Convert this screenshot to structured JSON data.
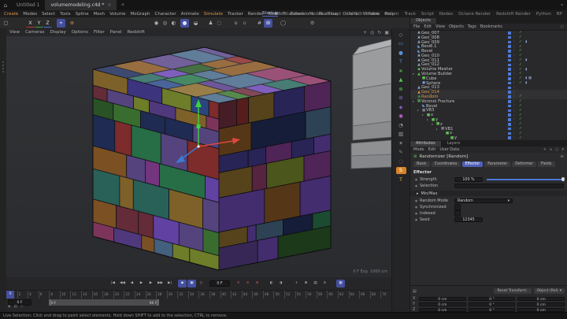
{
  "window": {
    "title_icon": "⌂",
    "tabs": [
      {
        "label": "Untitled 1",
        "active": false
      },
      {
        "label": "volumemodeling.c4d *",
        "active": true
      }
    ],
    "close_glyph": "×",
    "new_tab_glyph": "+",
    "corner_glyph": "▾"
  },
  "menubar": {
    "items": [
      {
        "label": "Create",
        "accent": true
      },
      {
        "label": "Modes"
      },
      {
        "label": "Select"
      },
      {
        "label": "Tools"
      },
      {
        "label": "Spline"
      },
      {
        "label": "Mesh"
      },
      {
        "label": "Volume"
      },
      {
        "label": "MoGraph"
      },
      {
        "label": "Character"
      },
      {
        "label": "Animate"
      },
      {
        "label": "Simulate",
        "accent": true
      },
      {
        "label": "Tracker"
      },
      {
        "label": "Render"
      },
      {
        "label": "Redshift"
      },
      {
        "label": "Extensions"
      },
      {
        "label": "RealFlow"
      },
      {
        "label": "Octane"
      },
      {
        "label": "Window"
      },
      {
        "label": "Help"
      }
    ]
  },
  "layout_tabs": {
    "items": [
      {
        "label": "Startup",
        "active": true
      },
      {
        "label": "Standard"
      },
      {
        "label": "Model"
      },
      {
        "label": "Sculpt"
      },
      {
        "label": "UV Edit"
      },
      {
        "label": "Paint"
      },
      {
        "label": "Groom"
      },
      {
        "label": "Track"
      },
      {
        "label": "Script"
      },
      {
        "label": "Nodes"
      },
      {
        "label": "Octane Render"
      },
      {
        "label": "Redshift Render"
      },
      {
        "label": "Python"
      },
      {
        "label": "BP"
      }
    ]
  },
  "toolbar": {
    "items": [
      {
        "n": "selection-tool-icon",
        "g": "▢"
      },
      {
        "n": "x-axis-button",
        "g": "X",
        "c": "#d8d8d8",
        "bb": "1.5px solid #c0392b",
        "ml": "20px"
      },
      {
        "n": "y-axis-button",
        "g": "Y",
        "c": "#d8d8d8",
        "bb": "1.5px solid #3fa03f"
      },
      {
        "n": "z-axis-button",
        "g": "Z",
        "c": "#d8d8d8",
        "bb": "1.5px solid #3f6fd0"
      },
      {
        "n": "axis-lock-button",
        "g": "⌖",
        "bg": "#44509e",
        "c": "#dfe3ff",
        "ml": "6px"
      },
      {
        "n": "coord-system-button",
        "g": "⊕",
        "c": "#c08a4a",
        "ml": "3px"
      },
      {
        "n": "render-view-button",
        "g": "◉",
        "ml": "96px"
      },
      {
        "n": "render-region-button",
        "g": "◎"
      },
      {
        "n": "render-ipr-button",
        "g": "◐"
      },
      {
        "n": "render-settings-button",
        "g": "●",
        "bg": "#44509e",
        "c": "#dfe3ff",
        "ml": "3px"
      },
      {
        "n": "render-team-button",
        "g": "◒",
        "ml": "3px"
      },
      {
        "n": "character-button",
        "g": "♟",
        "ml": "8px"
      },
      {
        "n": "placeholder-button",
        "g": "▢",
        "c": "#777"
      },
      {
        "n": "snap-button",
        "g": "∪",
        "ml": "10px"
      },
      {
        "n": "snap-settings-button",
        "g": "∪",
        "c": "#9a9a9a"
      },
      {
        "n": "grid-button",
        "g": "#",
        "ml": "8px"
      },
      {
        "n": "quantize-button",
        "g": "⊞",
        "bg": "#44509e",
        "c": "#dfe3ff"
      },
      {
        "n": "modeling-circle-button",
        "g": "◯",
        "ml": "8px",
        "c": "#999999"
      },
      {
        "n": "settings-gear-button",
        "g": "⚙",
        "ml": "26px",
        "c": "#999999"
      }
    ]
  },
  "viewport": {
    "menu": [
      "View",
      "Cameras",
      "Display",
      "Options",
      "Filter",
      "Panel",
      "Redshift"
    ],
    "nav_icons": [
      {
        "n": "pan-icon",
        "g": "+"
      },
      {
        "n": "zoom-icon",
        "g": "◎"
      },
      {
        "n": "rotate-icon",
        "g": "↻"
      },
      {
        "n": "switch-view-icon",
        "g": "▣"
      }
    ],
    "hud": "0 F  Exp. 1000 cm",
    "cube": {
      "seed": 12345,
      "palette": [
        "#5a3f8c",
        "#6d49b4",
        "#433a8c",
        "#2f4f8c",
        "#23305c",
        "#2e6b62",
        "#2c7a4f",
        "#3f7a35",
        "#2e5c2b",
        "#7a8c2e",
        "#8c6d2e",
        "#8a5a27",
        "#8c3a66",
        "#803b8c",
        "#8c3030",
        "#70303f",
        "#4b6b8c",
        "#5e4b8c"
      ]
    }
  },
  "icon_strip": {
    "items": [
      {
        "n": "node-editor-icon",
        "g": "◇",
        "c": "#97a1c0"
      },
      {
        "n": "frame-icon",
        "g": "▭",
        "c": "#5e8fd8"
      },
      {
        "n": "sphere-icon",
        "g": "●",
        "c": "#5e8fd8"
      },
      {
        "n": "text-icon",
        "g": "T",
        "c": "#5e8fd8"
      },
      {
        "n": "cloner-icon",
        "g": "∗",
        "c": "#5bc24f"
      },
      {
        "n": "volume-builder-icon",
        "g": "▲",
        "c": "#5bc24f"
      },
      {
        "n": "effector-icon",
        "g": "⊛",
        "c": "#5bc24f"
      },
      {
        "n": "field-icon",
        "g": "⊘",
        "c": "#9a6fd8"
      },
      {
        "n": "field-node-icon",
        "g": "◈",
        "c": "#9a6fd8"
      },
      {
        "n": "group-icon",
        "g": "◉",
        "c": "#c46ad6"
      },
      {
        "n": "time-icon",
        "g": "◔",
        "c": "#a8a8a8"
      },
      {
        "n": "camera-icon",
        "g": "▥",
        "c": "#a8a8a8"
      },
      {
        "n": "light-icon",
        "g": "☀",
        "c": "#a8a8a8"
      },
      {
        "n": "pen-icon",
        "g": "✎",
        "c": "#8a8a8a"
      },
      {
        "n": "ring-icon",
        "g": "◌",
        "c": "#8a8a8a"
      },
      {
        "n": "sculpt-icon",
        "g": "S",
        "c": "#ffffff",
        "bg": "#d88327"
      },
      {
        "n": "uv-text-icon",
        "g": "T",
        "c": "#e0b33c"
      }
    ]
  },
  "object_manager": {
    "tab": "Objects",
    "menu": [
      "File",
      "Edit",
      "View",
      "Objects",
      "Tags",
      "Bookmarks"
    ],
    "search_glyph": "○",
    "dots_glyph": ":",
    "items": [
      {
        "n": "Geo_007",
        "g": "▲",
        "c": "#8fa8c8",
        "pl": "3px",
        "chk": "✓"
      },
      {
        "n": "Geo_008",
        "g": "▲",
        "c": "#8fa8c8",
        "pl": "3px",
        "chk": "✓"
      },
      {
        "n": "Geo_009",
        "g": "▲",
        "c": "#8fa8c8",
        "pl": "3px",
        "chk": "✓",
        "tags": "◖"
      },
      {
        "n": "Bevel.1",
        "g": "◣",
        "c": "#6fa0e0",
        "pl": "3px",
        "chk": "✓"
      },
      {
        "n": "Bevel",
        "g": "◣",
        "c": "#6fa0e0",
        "pl": "3px",
        "chk": "✓"
      },
      {
        "n": "Geo_010",
        "g": "▲",
        "c": "#8fa8c8",
        "pl": "3px",
        "chk": "✓"
      },
      {
        "n": "Geo_011",
        "g": "▲",
        "c": "#8fa8c8",
        "pl": "3px",
        "chk": "✓",
        "tags": "◖"
      },
      {
        "n": "Geo_012",
        "g": "▲",
        "c": "#8fa8c8",
        "pl": "3px",
        "chk": "✓"
      },
      {
        "n": "Volume Mesher",
        "g": "◆",
        "c": "#5bc24f",
        "pl": "3px",
        "chk": "✓",
        "tags": "◖"
      },
      {
        "n": "Volume Builder",
        "g": "▲",
        "c": "#5bc24f",
        "pl": "3px",
        "e": "▾",
        "chk": "✓"
      },
      {
        "n": "Cube",
        "g": "■",
        "c": "#5bc24f",
        "pl": "9px",
        "chk": "✓",
        "tags": "◖▦"
      },
      {
        "n": "Sphere",
        "g": "●",
        "c": "#6fa0e0",
        "pl": "9px",
        "chk": "✓",
        "tags": "◖"
      },
      {
        "n": "Geo_013",
        "g": "▲",
        "c": "#8fa8c8",
        "pl": "3px",
        "chk": ""
      },
      {
        "n": "Geo_014",
        "g": "▲",
        "c": "#e09543",
        "pl": "3px",
        "sel": true,
        "chk": ""
      },
      {
        "n": "Random",
        "g": "⊛",
        "c": "#5bc24f",
        "pl": "3px",
        "sel": true,
        "chk": "✓"
      },
      {
        "n": "Voronoi Fracture",
        "g": "▦",
        "c": "#5bc24f",
        "pl": "3px",
        "e": "▾",
        "chk": "✓"
      },
      {
        "n": "Bevel",
        "g": "◣",
        "c": "#6fa0e0",
        "pl": "9px",
        "chk": "✓"
      },
      {
        "n": "VB3",
        "g": "▦",
        "c": "#9aa4b8",
        "pl": "9px",
        "e": "▸",
        "chk": "✓"
      },
      {
        "n": "x",
        "g": "■",
        "c": "#5bc24f",
        "pl": "15px",
        "e": "▸",
        "chk": "✓"
      },
      {
        "n": "y",
        "g": "■",
        "c": "#5bc24f",
        "pl": "21px",
        "e": "▸",
        "chk": "✓"
      },
      {
        "n": "z",
        "g": "■",
        "c": "#5bc24f",
        "pl": "27px",
        "e": "▾",
        "chk": "✓"
      },
      {
        "n": "VB1",
        "g": "▦",
        "c": "#9aa4b8",
        "pl": "33px",
        "e": "▸",
        "chk": "✓"
      },
      {
        "n": "x",
        "g": "■",
        "c": "#5bc24f",
        "pl": "39px",
        "chk": "✓"
      },
      {
        "n": "y",
        "g": "■",
        "c": "#5bc24f",
        "pl": "45px",
        "chk": "✓"
      }
    ]
  },
  "attributes": {
    "tabs": [
      {
        "label": "Attributes",
        "active": true
      },
      {
        "label": "Layers"
      }
    ],
    "menu": [
      "Mode",
      "Edit",
      "User Data"
    ],
    "menu_icons": [
      {
        "n": "add-icon",
        "g": "+"
      },
      {
        "n": "home-icon",
        "g": "⌂"
      },
      {
        "n": "search-icon",
        "g": "○"
      },
      {
        "n": "dropdown-icon",
        "g": "▾"
      }
    ],
    "object_icon": "⊛",
    "title": "Randomizer [Random]",
    "title_menu_glyph": "≡",
    "param_tabs": [
      {
        "label": "Basic"
      },
      {
        "label": "Coordinates"
      },
      {
        "label": "Effector",
        "active": true
      },
      {
        "label": "Parameter"
      },
      {
        "label": "Deformer"
      },
      {
        "label": "Fields"
      }
    ],
    "section": "Effector",
    "strength_label": "Strength",
    "strength_value": "100 %",
    "selection_label": "Selection",
    "group_caret": "▸",
    "group_label": "Min/Max",
    "mode_label": "Random Mode",
    "mode_value": "Random",
    "mode_caret": "▾",
    "sync_label": "Synchronized",
    "indexed_label": "Indexed",
    "seed_label": "Seed",
    "seed_value": "12345"
  },
  "coordinates": {
    "menu_glyph": "▤",
    "buttons": [
      {
        "label": "Reset Transform",
        "caret": ""
      },
      {
        "label": "Object (Rel)",
        "caret": "▾"
      }
    ],
    "rows": [
      {
        "axis": "X",
        "p": "0 cm",
        "r": "0 °",
        "s": "0 cm"
      },
      {
        "axis": "Y",
        "p": "0 cm",
        "r": "0 °",
        "s": "0 cm"
      },
      {
        "axis": "Z",
        "p": "0 cm",
        "r": "0 °",
        "s": "0 cm"
      }
    ]
  },
  "timeline": {
    "transport": [
      {
        "n": "goto-start-button",
        "g": "|◀"
      },
      {
        "n": "prev-key-button",
        "g": "◀◀"
      },
      {
        "n": "prev-frame-button",
        "g": "◀"
      },
      {
        "n": "play-button",
        "g": "▶"
      },
      {
        "n": "next-frame-button",
        "g": "▶"
      },
      {
        "n": "next-key-button",
        "g": "▶▶"
      },
      {
        "n": "goto-end-button",
        "g": "▶|"
      }
    ],
    "key_buttons": [
      {
        "n": "record-keyframe-button",
        "g": "◆",
        "bg": "#44509e",
        "c": "#dfe3ff",
        "ml": "4px"
      },
      {
        "n": "autokey-button",
        "g": "▣",
        "bg": "#44509e",
        "c": "#dfe3ff"
      },
      {
        "n": "keyframe-selection-button",
        "g": "◇"
      }
    ],
    "frame_field": "0 F",
    "record_buttons": [
      {
        "n": "record-position-button",
        "g": "⊘",
        "c": "#cc5348"
      },
      {
        "n": "record-scale-button",
        "g": "⊘",
        "c": "#cc5348"
      },
      {
        "n": "record-rotation-button",
        "g": "⊗",
        "c": "#cc5348"
      },
      {
        "n": "record-parameter-button",
        "g": "◐",
        "ml": "6px"
      },
      {
        "n": "record-pla-button",
        "g": "◑"
      },
      {
        "n": "move-keys-button",
        "g": "+",
        "ml": "8px"
      },
      {
        "n": "scale-keys-button",
        "g": "⊞"
      },
      {
        "n": "clamp-button",
        "g": "▤"
      },
      {
        "n": "ripple-button",
        "g": "≋"
      },
      {
        "n": "snapshot-button",
        "g": "▦",
        "bg": "#44509e",
        "c": "#dfe3ff",
        "ml": "8px"
      }
    ],
    "ruler_labels": [
      0,
      2,
      4,
      6,
      8,
      10,
      12,
      14,
      16,
      18,
      20,
      22,
      24,
      26,
      28,
      30,
      32,
      34,
      36,
      38,
      40,
      42,
      44,
      46,
      48,
      50,
      52,
      54,
      56,
      58,
      60,
      62,
      64,
      66,
      68,
      70
    ],
    "playhead_label": "0",
    "range_field": "0 F",
    "range_start": "0 F",
    "range_end": "90 F",
    "extra_icons": [
      {
        "n": "key-icon",
        "g": "◆"
      },
      {
        "n": "cam-icon",
        "g": "▤"
      },
      {
        "n": "options-icon",
        "g": "◇"
      }
    ]
  },
  "status": {
    "text": "Live Selection: Click and drag to paint select elements. Hold down SHIFT to add to the selection, CTRL to remove."
  }
}
